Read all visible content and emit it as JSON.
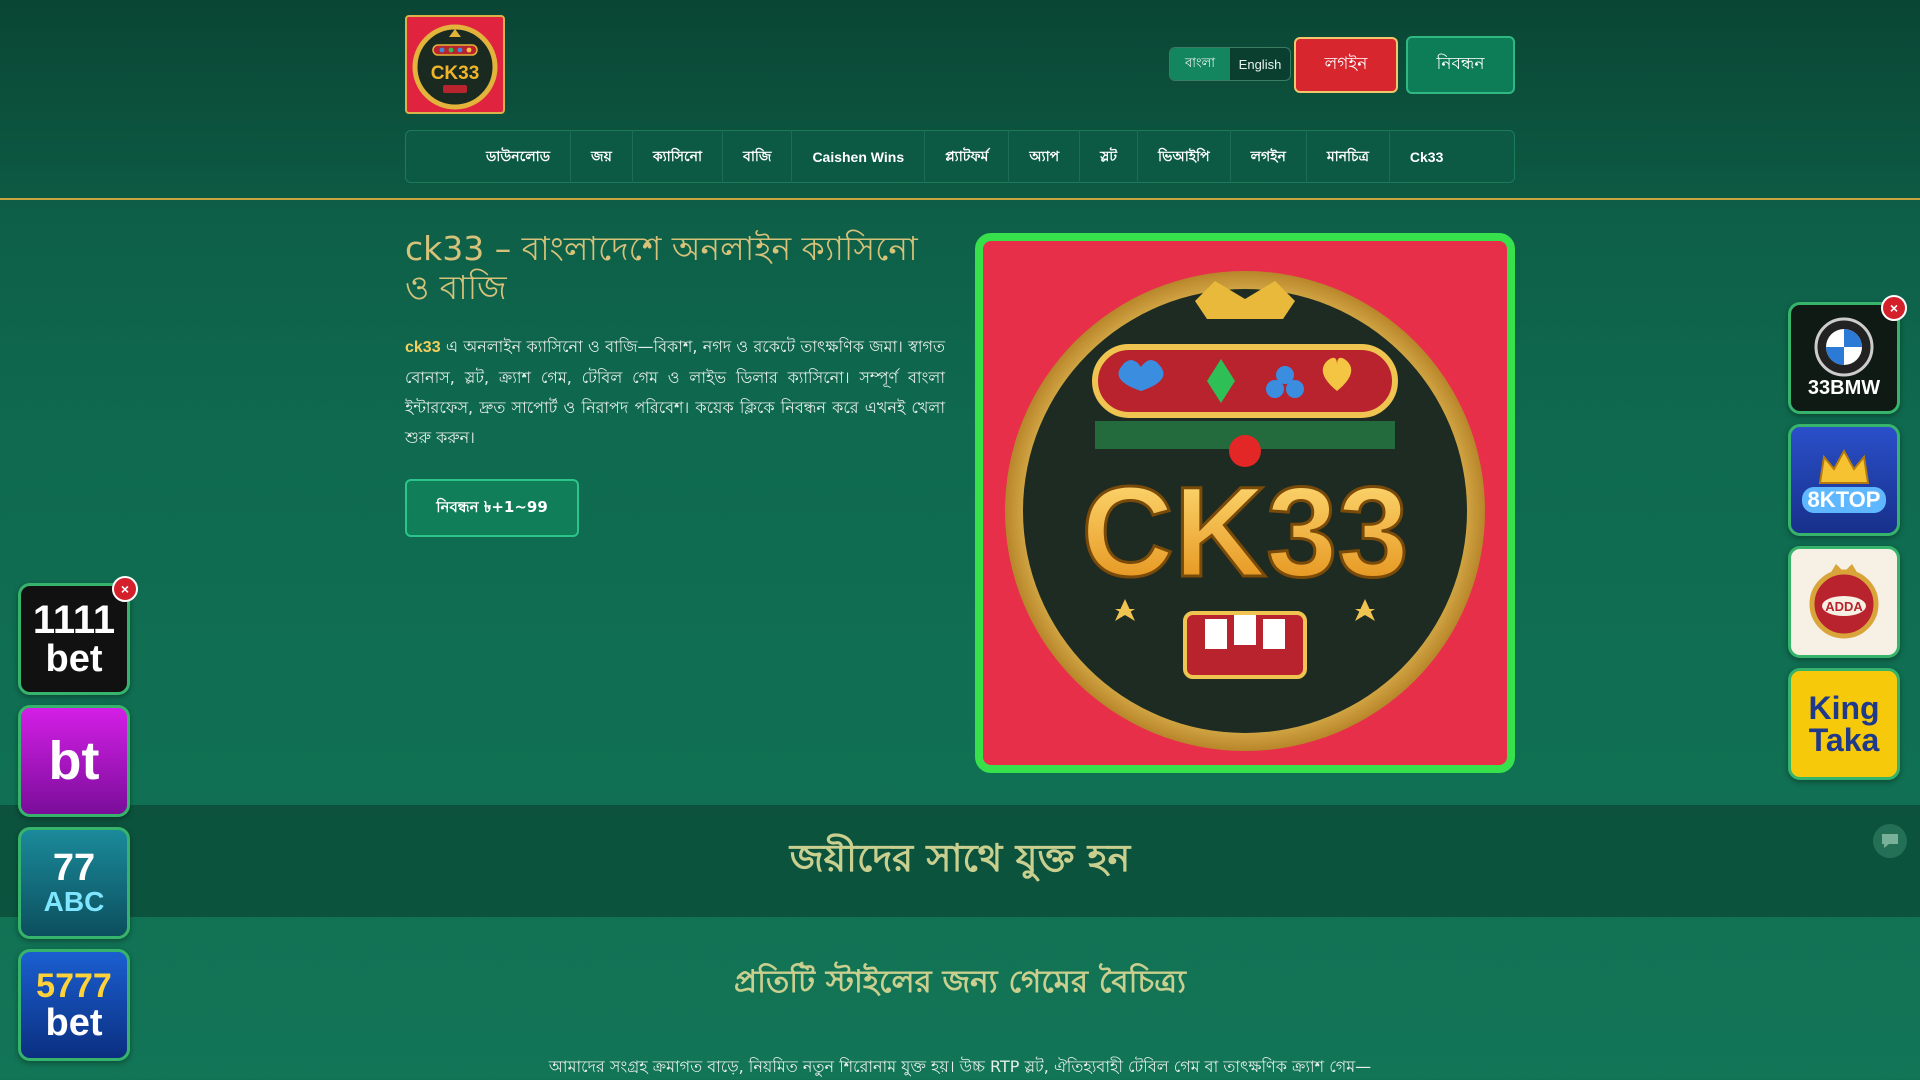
{
  "header": {
    "logo_text": "CK33",
    "language": {
      "options": [
        "বাংলা",
        "English"
      ],
      "selected": "বাংলা"
    },
    "login_label": "লগইন",
    "register_label": "নিবন্ধন"
  },
  "nav": {
    "items": [
      "ডাউনলোড",
      "জয়",
      "ক্যাসিনো",
      "বাজি",
      "Caishen Wins",
      "প্ল্যাটফর্ম",
      "অ্যাপ",
      "স্লট",
      "ভিআইপি",
      "লগইন",
      "মানচিত্র",
      "Ck33"
    ]
  },
  "hero": {
    "title": "ck33 – বাংলাদেশে অনলাইন ক্যাসিনো ও বাজি",
    "brand": "ck33",
    "description": "এ অনলাইন ক্যাসিনো ও বাজি—বিকাশ, নগদ ও রকেটে তাৎক্ষণিক জমা। স্বাগত বোনাস, স্লট, ক্র্যাশ গেম, টেবিল গেম ও লাইভ ডিলার ক্যাসিনো। সম্পূর্ণ বাংলা ইন্টারফেস, দ্রুত সাপোর্ট ও নিরাপদ পরিবেশ। কয়েক ক্লিকে নিবন্ধন করে এখনই খেলা শুরু করুন।",
    "cta_label": "নিবন্ধন ৳+1~99",
    "image_text": "CK33"
  },
  "sections": {
    "join_title": "জয়ীদের সাথে যুক্ত হন",
    "variety_title": "প্রতিটি স্টাইলের জন্য গেমের বৈচিত্র্য",
    "collection_text": "আমাদের সংগ্রহ ক্রমাগত বাড়ে, নিয়মিত নতুন শিরোনাম যুক্ত হয়। উচ্চ RTP স্লট, ঐতিহ্যবাহী টেবিল গেম বা তাৎক্ষণিক ক্র্যাশ গেম—"
  },
  "left_promos": {
    "close_label": "×",
    "tiles": [
      {
        "line1": "1111",
        "line2": "bet"
      },
      {
        "line1": "bt",
        "line2": ""
      },
      {
        "line1": "77",
        "line2": "ABC"
      },
      {
        "line1": "5777",
        "line2": "bet"
      }
    ]
  },
  "right_promos": {
    "close_label": "×",
    "tiles": [
      {
        "line1": "33BMW",
        "line2": ""
      },
      {
        "line1": "8KTOP",
        "line2": ""
      },
      {
        "line1": "ADDA",
        "line2": ""
      },
      {
        "line1": "King",
        "line2": "Taka"
      }
    ]
  },
  "colors": {
    "accent_green": "#36e14b",
    "login_red": "#d7262e",
    "title_gold": "#d7c27a"
  }
}
